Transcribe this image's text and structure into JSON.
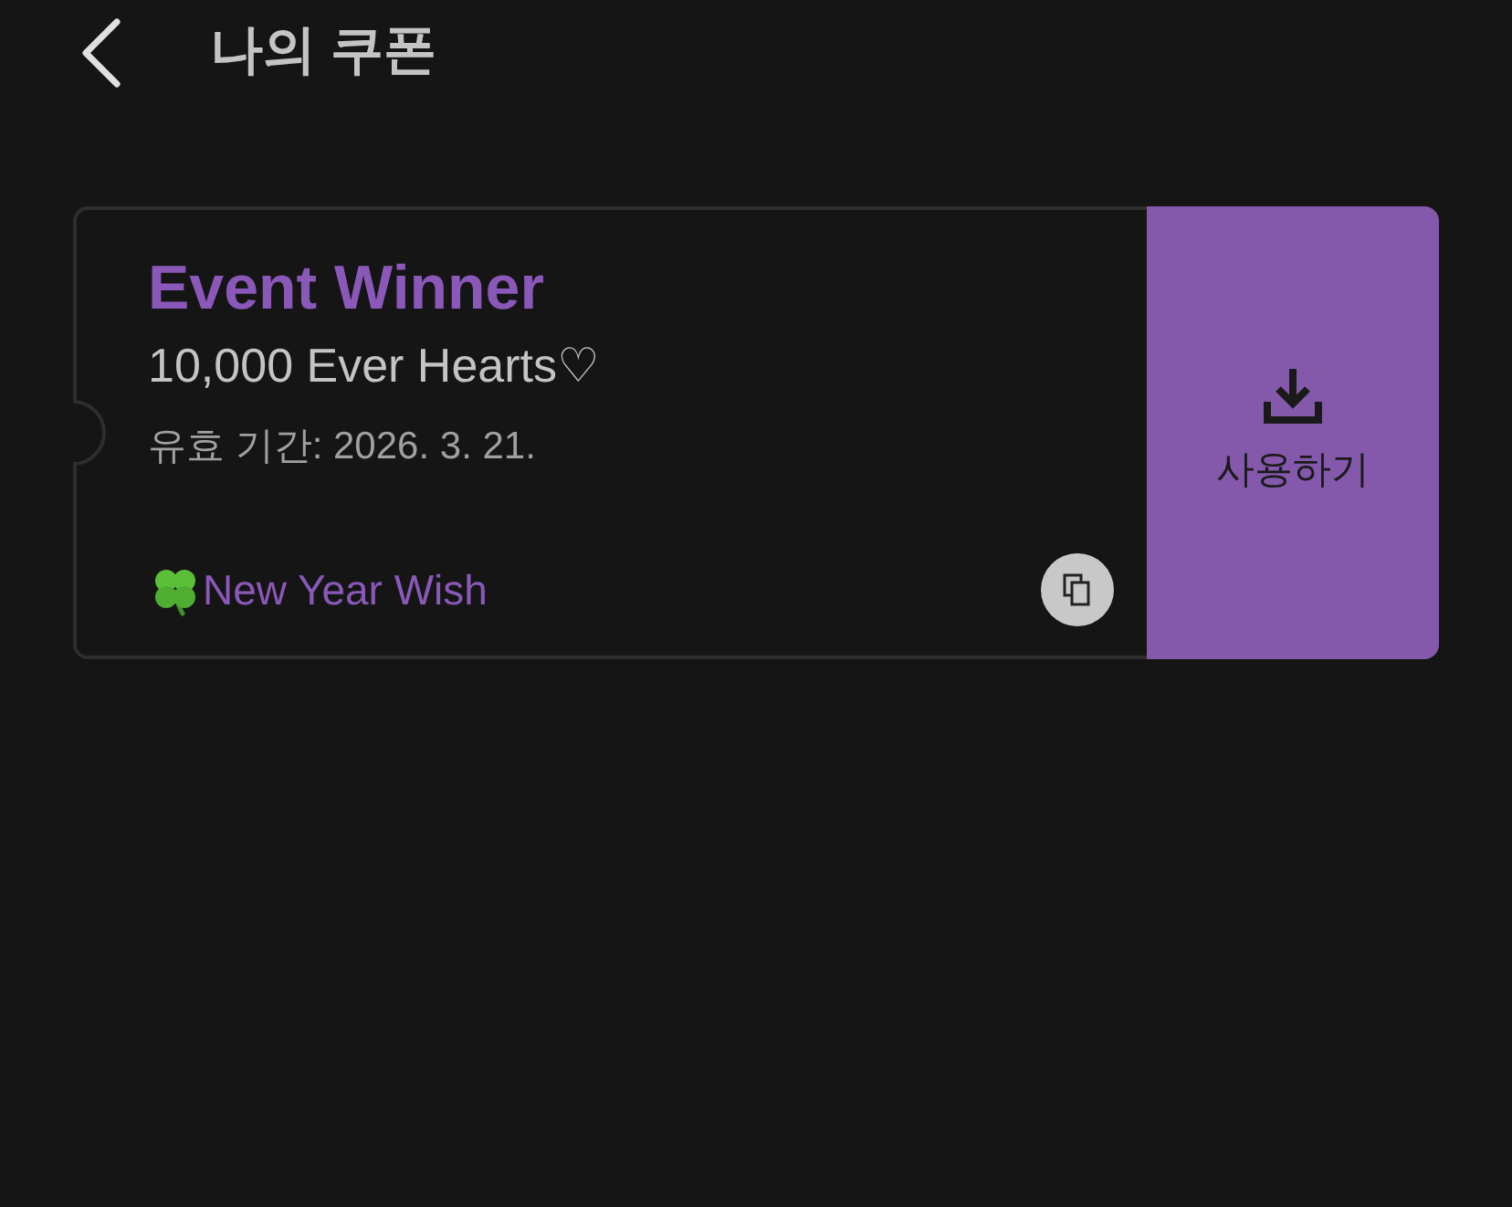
{
  "header": {
    "title": "나의 쿠폰"
  },
  "coupons": [
    {
      "title": "Event Winner",
      "reward": "10,000 Ever Hearts♡",
      "validity": "유효 기간: 2026. 3. 21.",
      "tag": "New Year Wish",
      "action": "사용하기"
    }
  ]
}
